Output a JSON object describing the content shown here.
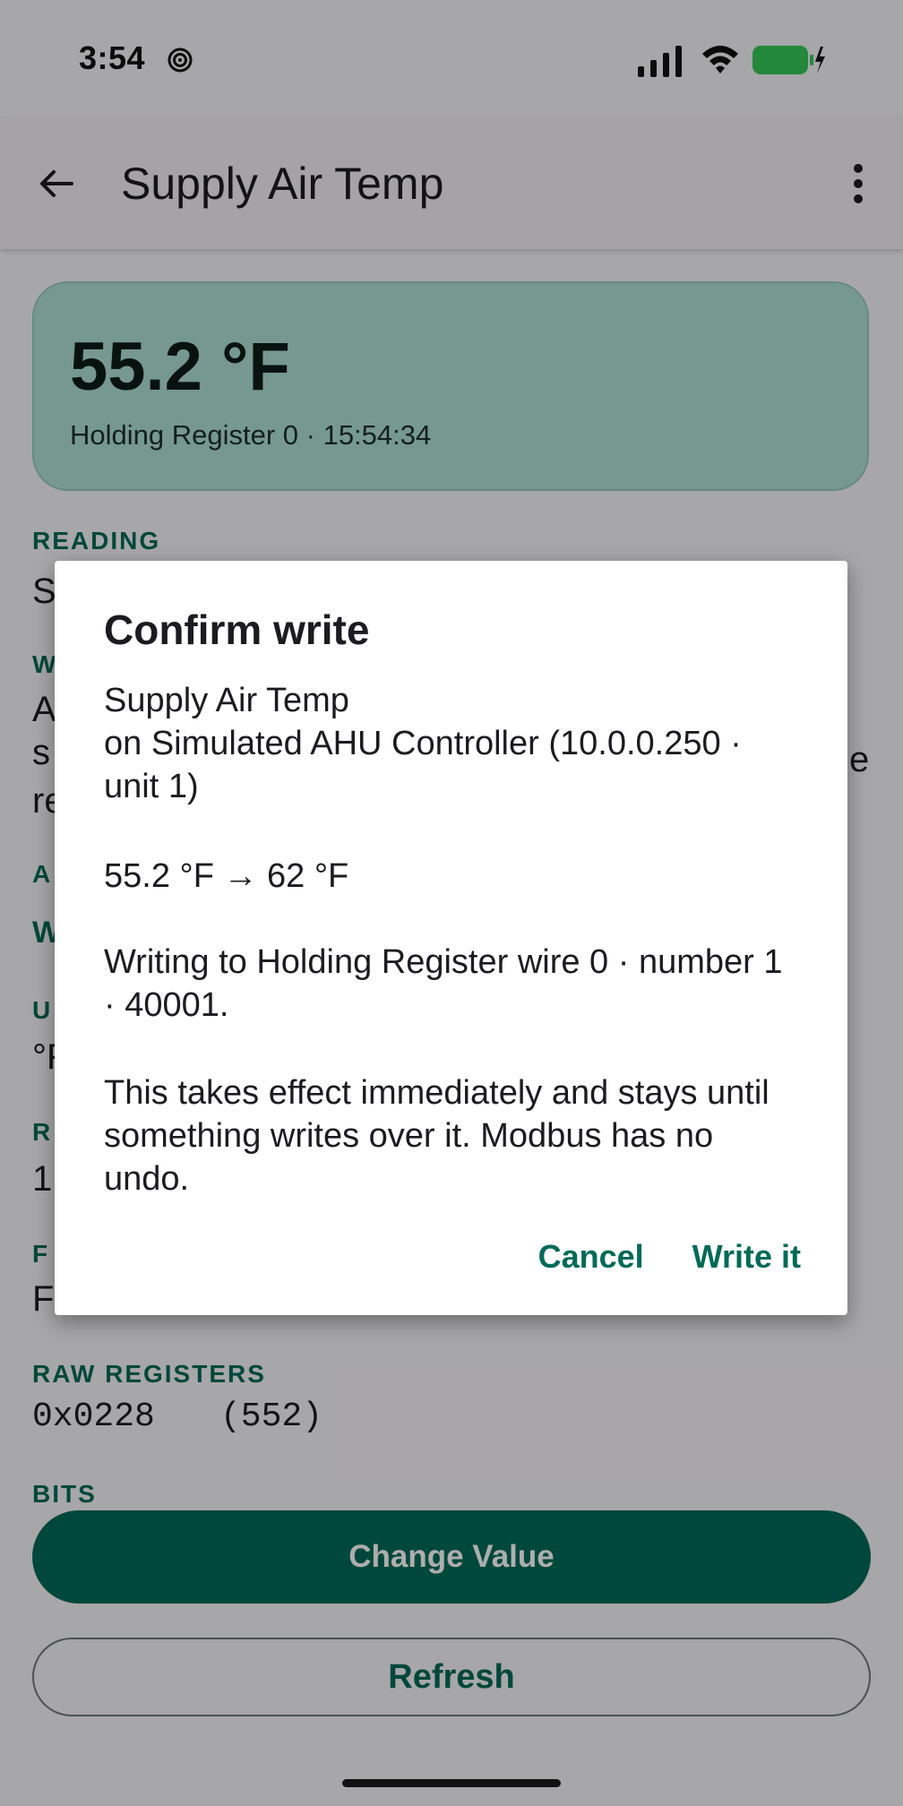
{
  "status_bar": {
    "time": "3:54",
    "icons": [
      "focus-icon",
      "signal-icon",
      "wifi-icon",
      "battery-charging-icon"
    ],
    "battery_color": "#34c759"
  },
  "app_bar": {
    "title": "Supply Air Temp",
    "back_icon": "arrow-left-icon",
    "menu_icon": "more-vertical-icon"
  },
  "reading_card": {
    "value": "55.2 °F",
    "meta": "Holding Register 0 · 15:54:34"
  },
  "sections": {
    "reading_label": "READING",
    "reading_value_visible": "S",
    "write_label_visible": "W",
    "description_line1_visible": "A",
    "description_line1_right_visible": "e",
    "description_line2_visible": "s",
    "description_line3_visible": "re",
    "a_label_visible": "A",
    "w_value_visible": "W",
    "unit_label_visible": "U",
    "unit_value_visible": "°F",
    "r_label_visible": "R",
    "r_value_visible": "1",
    "function_label_visible": "F",
    "function_value_visible": "F",
    "raw_registers_label": "RAW REGISTERS",
    "raw_hex": "0x0228",
    "raw_dec": "(552)",
    "bits_label": "BITS"
  },
  "buttons": {
    "change_value": "Change Value",
    "refresh": "Refresh"
  },
  "dialog": {
    "title": "Confirm write",
    "target_line1": "Supply Air Temp",
    "target_line2": "on Simulated AHU Controller (10.0.0.250 · unit 1)",
    "change": "55.2 °F → 62 °F",
    "address": "Writing to Holding Register wire 0 · number 1 · 40001.",
    "warning": "This takes effect immediately and stays until something writes over it. Modbus has no undo.",
    "cancel": "Cancel",
    "confirm": "Write it"
  },
  "colors": {
    "accent": "#006b58",
    "card": "#aee1d4",
    "scrim": "rgba(0,0,0,0.32)"
  }
}
